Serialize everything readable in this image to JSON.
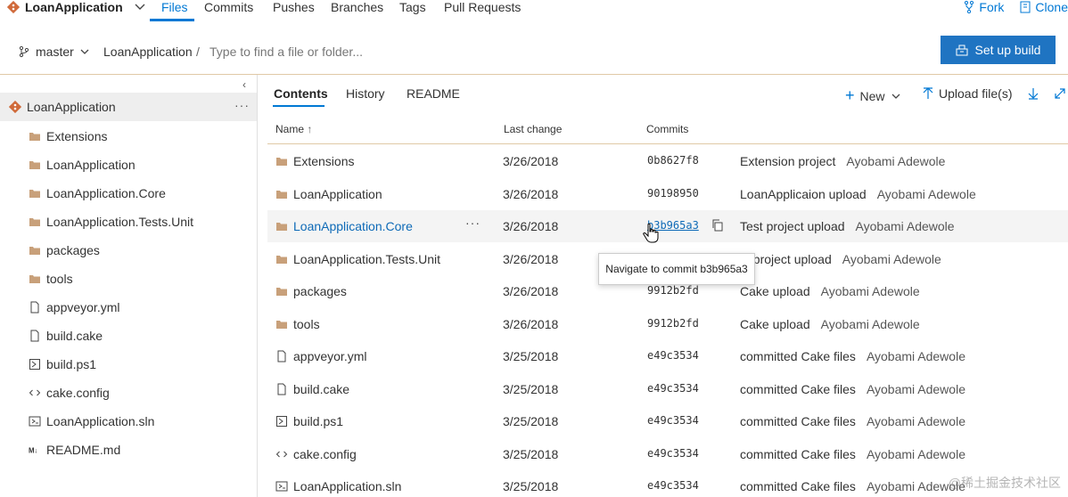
{
  "repo": {
    "name": "LoanApplication"
  },
  "nav": {
    "tabs": [
      "Files",
      "Commits",
      "Pushes",
      "Branches",
      "Tags",
      "Pull Requests"
    ],
    "fork": "Fork",
    "clone": "Clone"
  },
  "breadcrumb": {
    "branch": "master",
    "repo": "LoanApplication",
    "separator": "/",
    "search_placeholder": "Type to find a file or folder..."
  },
  "setup_build": "Set up build",
  "tree": {
    "root": "LoanApplication",
    "items": [
      {
        "label": "Extensions",
        "icon": "folder-icon"
      },
      {
        "label": "LoanApplication",
        "icon": "folder-icon"
      },
      {
        "label": "LoanApplication.Core",
        "icon": "folder-icon"
      },
      {
        "label": "LoanApplication.Tests.Unit",
        "icon": "folder-icon"
      },
      {
        "label": "packages",
        "icon": "folder-icon"
      },
      {
        "label": "tools",
        "icon": "folder-icon"
      },
      {
        "label": "appveyor.yml",
        "icon": "file-icon"
      },
      {
        "label": "build.cake",
        "icon": "file-icon"
      },
      {
        "label": "build.ps1",
        "icon": "powershell-icon"
      },
      {
        "label": "cake.config",
        "icon": "code-icon"
      },
      {
        "label": "LoanApplication.sln",
        "icon": "solution-icon"
      },
      {
        "label": "README.md",
        "icon": "markdown-icon"
      }
    ]
  },
  "content": {
    "tabs": [
      "Contents",
      "History",
      "README"
    ],
    "new_label": "New",
    "upload_label": "Upload file(s)",
    "columns": {
      "name": "Name",
      "sort": "↑",
      "last_change": "Last change",
      "commits": "Commits"
    },
    "rows": [
      {
        "name": "Extensions",
        "icon": "folder-icon",
        "date": "3/26/2018",
        "hash": "0b8627f8",
        "message": "Extension project",
        "author": "Ayobami Adewole"
      },
      {
        "name": "LoanApplication",
        "icon": "folder-icon",
        "date": "3/26/2018",
        "hash": "90198950",
        "message": "LoanApplicaion upload",
        "author": "Ayobami Adewole"
      },
      {
        "name": "LoanApplication.Core",
        "icon": "folder-icon",
        "date": "3/26/2018",
        "hash": "b3b965a3",
        "message": "Test project upload",
        "author": "Ayobami Adewole"
      },
      {
        "name": "LoanApplication.Tests.Unit",
        "icon": "folder-icon",
        "date": "3/26/2018",
        "hash": "",
        "message": "st project upload",
        "author": "Ayobami Adewole"
      },
      {
        "name": "packages",
        "icon": "folder-icon",
        "date": "3/26/2018",
        "hash": "9912b2fd",
        "message": "Cake upload",
        "author": "Ayobami Adewole"
      },
      {
        "name": "tools",
        "icon": "folder-icon",
        "date": "3/26/2018",
        "hash": "9912b2fd",
        "message": "Cake upload",
        "author": "Ayobami Adewole"
      },
      {
        "name": "appveyor.yml",
        "icon": "file-icon",
        "date": "3/25/2018",
        "hash": "e49c3534",
        "message": "committed Cake files",
        "author": "Ayobami Adewole"
      },
      {
        "name": "build.cake",
        "icon": "file-icon",
        "date": "3/25/2018",
        "hash": "e49c3534",
        "message": "committed Cake files",
        "author": "Ayobami Adewole"
      },
      {
        "name": "build.ps1",
        "icon": "powershell-icon",
        "date": "3/25/2018",
        "hash": "e49c3534",
        "message": "committed Cake files",
        "author": "Ayobami Adewole"
      },
      {
        "name": "cake.config",
        "icon": "code-icon",
        "date": "3/25/2018",
        "hash": "e49c3534",
        "message": "committed Cake files",
        "author": "Ayobami Adewole"
      },
      {
        "name": "LoanApplication.sln",
        "icon": "solution-icon",
        "date": "3/25/2018",
        "hash": "e49c3534",
        "message": "committed Cake files",
        "author": "Ayobami Adewole"
      }
    ]
  },
  "tooltip": "Navigate to commit b3b965a3",
  "watermark": "@稀土掘金技术社区",
  "colors": {
    "accent": "#0078d4",
    "button": "#1f74c2",
    "folder": "#c8a07a",
    "divider": "#e0c9a6"
  }
}
